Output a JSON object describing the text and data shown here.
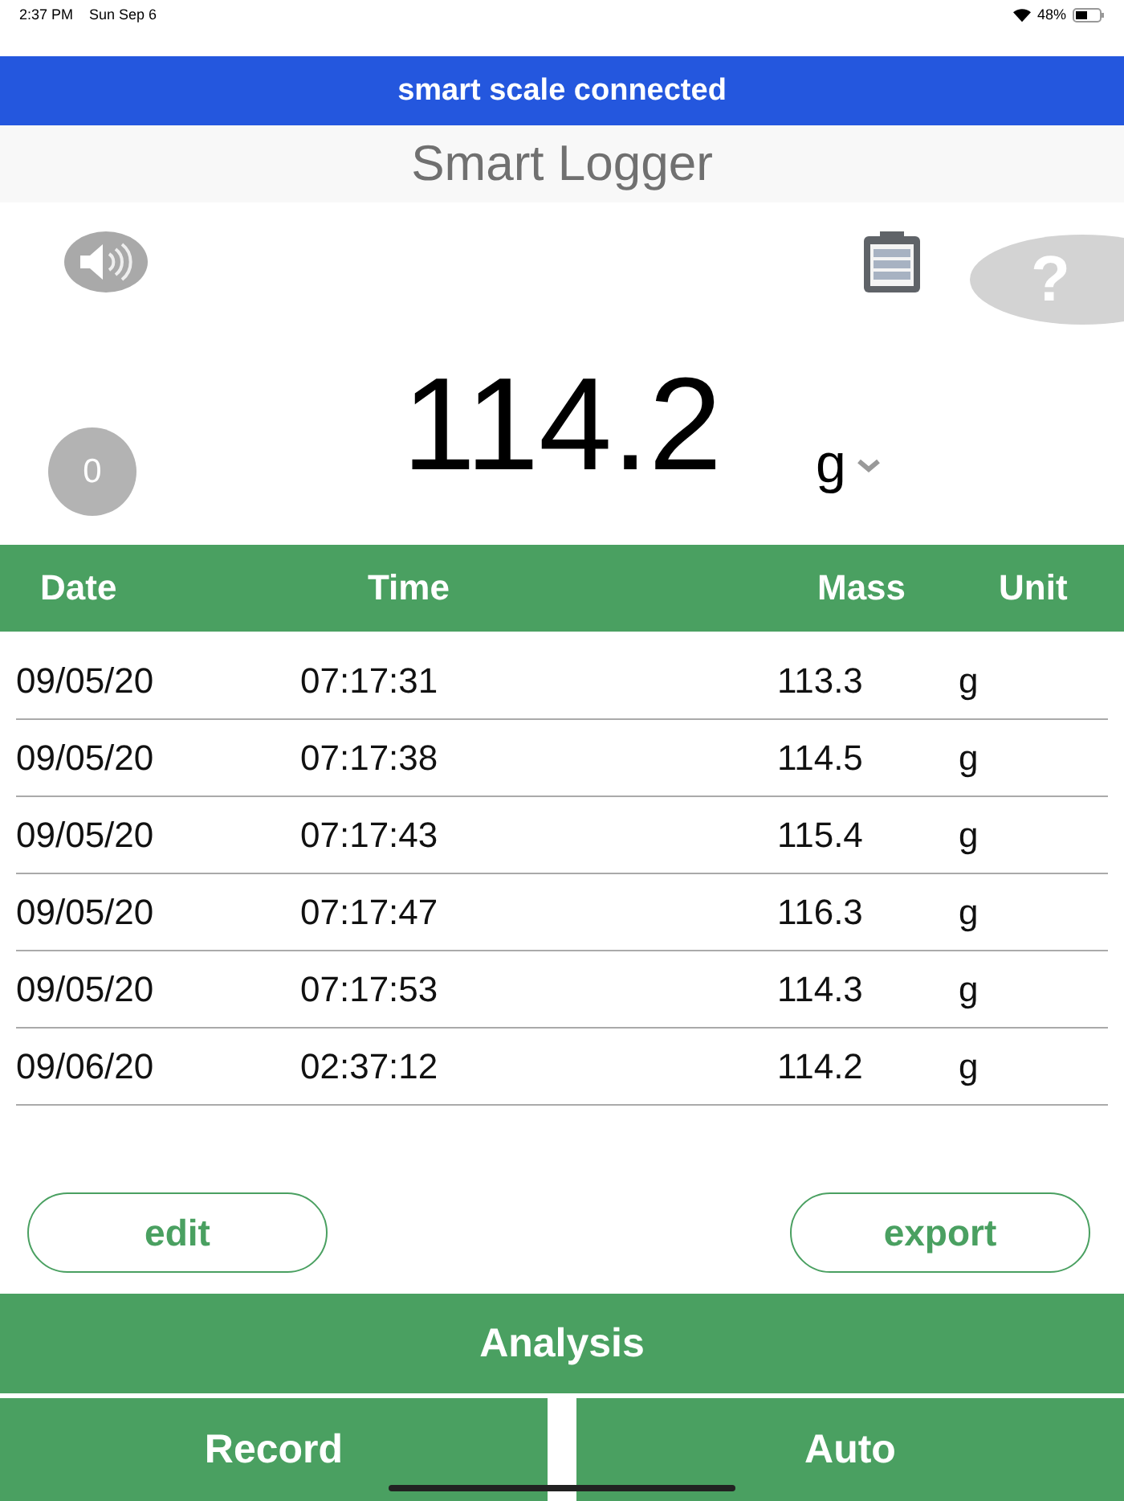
{
  "status_bar": {
    "time": "2:37 PM",
    "date": "Sun Sep 6",
    "battery": "48%"
  },
  "banner": "smart scale connected",
  "title": "Smart Logger",
  "help": "?",
  "zero_button": "0",
  "reading": {
    "value": "114.2",
    "unit": "g"
  },
  "table": {
    "columns": [
      "Date",
      "Time",
      "Mass",
      "Unit"
    ],
    "rows": [
      [
        "09/05/20",
        "07:17:31",
        "113.3",
        "g"
      ],
      [
        "09/05/20",
        "07:17:38",
        "114.5",
        "g"
      ],
      [
        "09/05/20",
        "07:17:43",
        "115.4",
        "g"
      ],
      [
        "09/05/20",
        "07:17:47",
        "116.3",
        "g"
      ],
      [
        "09/05/20",
        "07:17:53",
        "114.3",
        "g"
      ],
      [
        "09/06/20",
        "02:37:12",
        "114.2",
        "g"
      ]
    ]
  },
  "actions": [
    "edit",
    "export"
  ],
  "analysis": "Analysis",
  "bottom_buttons": [
    "Record",
    "Auto"
  ]
}
